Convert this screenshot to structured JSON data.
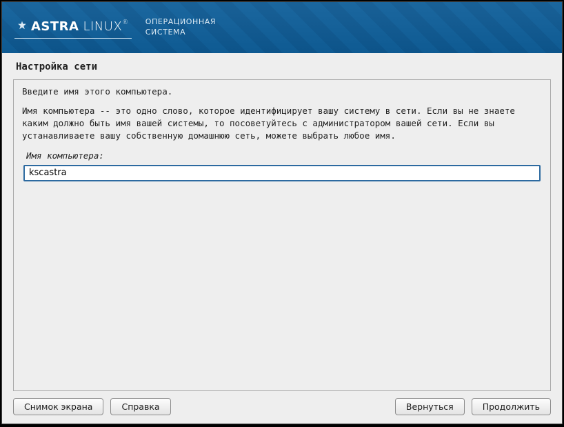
{
  "header": {
    "brand_astra": "ASTRA",
    "brand_linux": "LINUX",
    "registered": "®",
    "subtitle_line1": "ОПЕРАЦИОННАЯ",
    "subtitle_line2": "СИСТЕМА"
  },
  "page": {
    "title": "Настройка сети"
  },
  "content": {
    "intro": "Введите имя этого компьютера.",
    "desc": "Имя компьютера -- это одно слово, которое идентифицирует вашу систему в сети. Если вы не знаете каким должно быть имя вашей системы, то посоветуйтесь с администратором вашей сети. Если вы устанавливаете вашу собственную домашнюю сеть, можете выбрать любое имя.",
    "label": "Имя компьютера:",
    "input_value": "kscastra"
  },
  "buttons": {
    "screenshot": "Снимок экрана",
    "help": "Справка",
    "back": "Вернуться",
    "continue": "Продолжить"
  },
  "colors": {
    "header_bg": "#0d5891",
    "input_border": "#2d6aa0",
    "panel_bg": "#eeeeee"
  }
}
